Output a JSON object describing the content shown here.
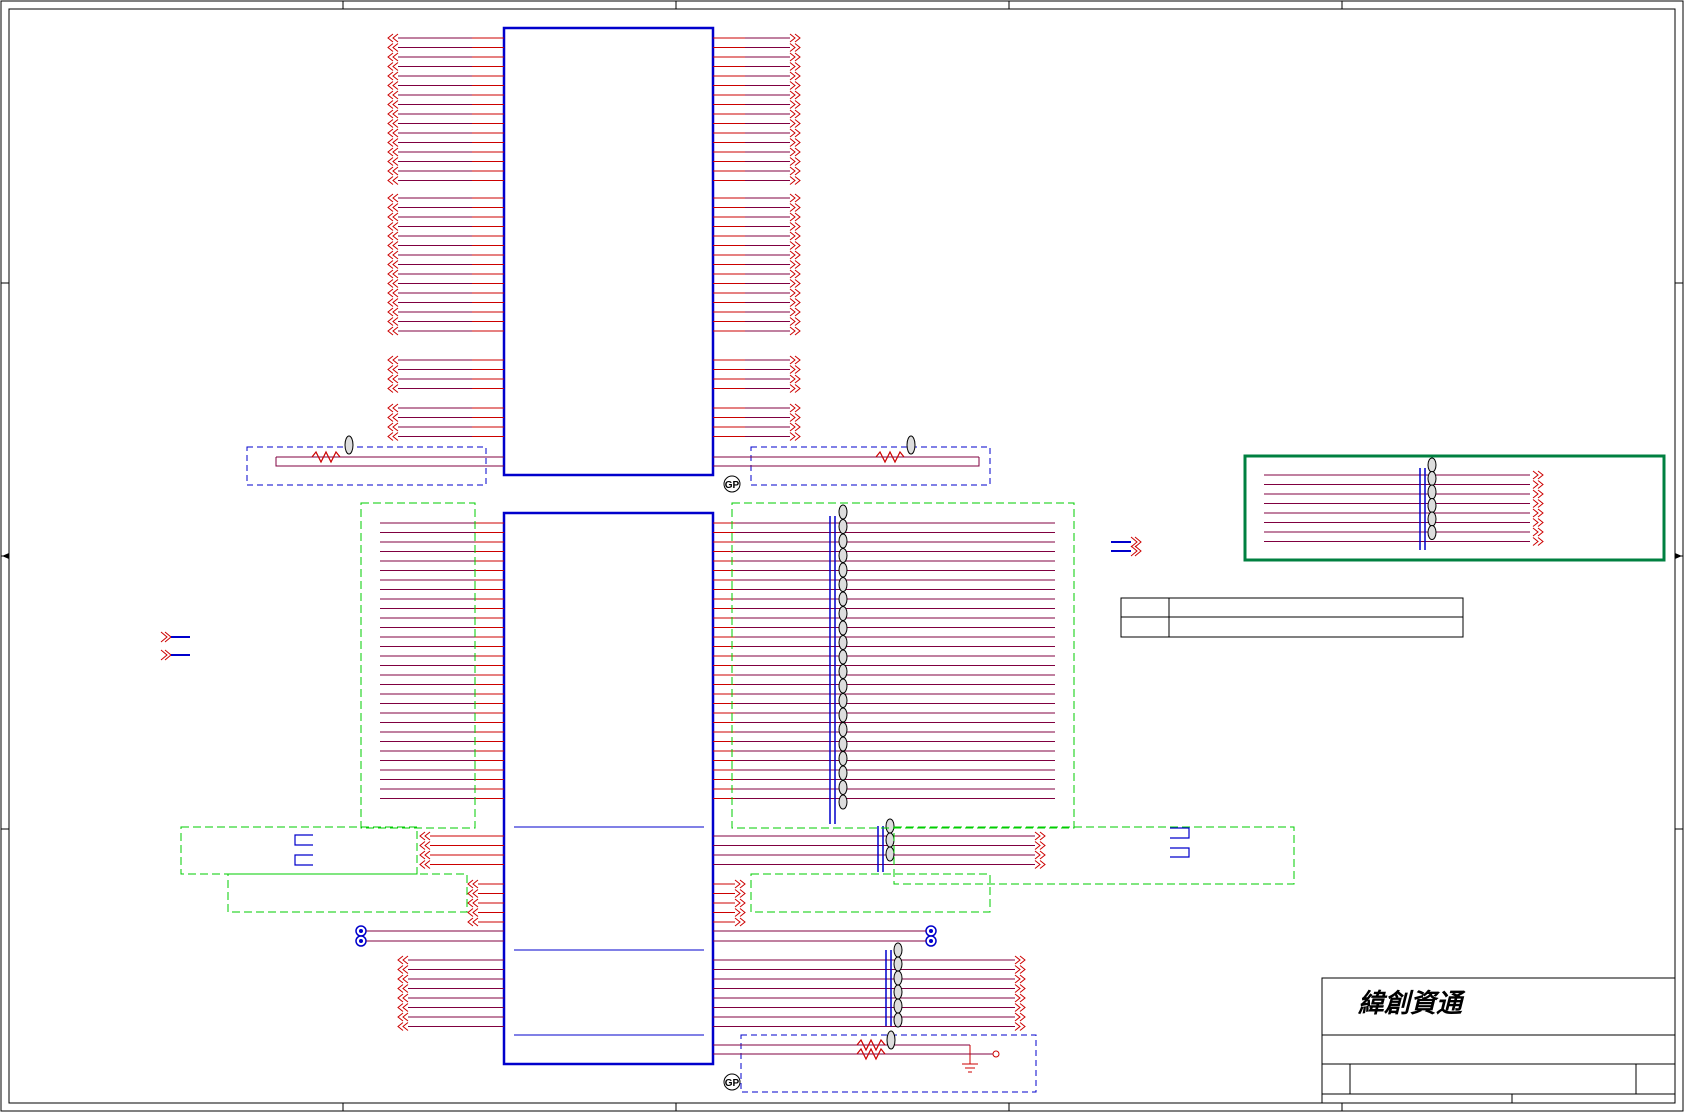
{
  "title_block": {
    "company": "緯創資通"
  },
  "symbols": {
    "test_point_top": "GP",
    "test_point_bottom": "GP"
  },
  "colors": {
    "wire": "#cc0000",
    "net": "#800040",
    "component": "#0000cc",
    "border": "#000000",
    "group_green": "#00cc00",
    "group_blue_dash": "#0000cc",
    "highlight_box": "#008040"
  }
}
